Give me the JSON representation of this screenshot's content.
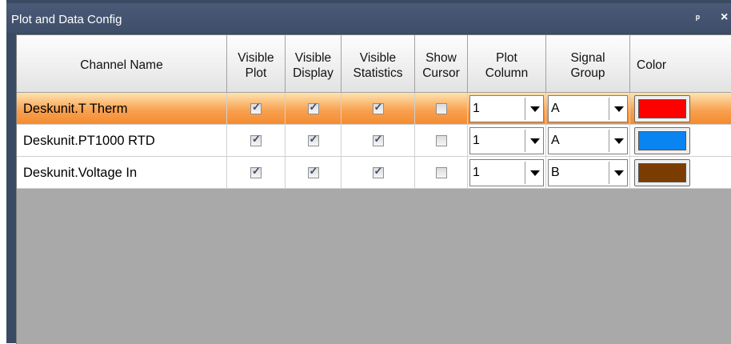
{
  "panel": {
    "title": "Plot and Data Config",
    "pin_glyph": "ᵖ",
    "close_glyph": "×"
  },
  "columns": {
    "channel_name": "Channel Name",
    "visible_plot": [
      "Visible",
      "Plot"
    ],
    "visible_display": [
      "Visible",
      "Display"
    ],
    "visible_statistics": [
      "Visible",
      "Statistics"
    ],
    "show_cursor": [
      "Show",
      "Cursor"
    ],
    "plot_column": [
      "Plot",
      "Column"
    ],
    "signal_group": [
      "Signal",
      "Group"
    ],
    "color": "Color"
  },
  "rows": [
    {
      "name": "Deskunit.T Therm",
      "visible_plot": true,
      "visible_display": true,
      "visible_statistics": true,
      "show_cursor": false,
      "plot_column": "1",
      "signal_group": "A",
      "color": "#ff0000",
      "selected": true
    },
    {
      "name": "Deskunit.PT1000 RTD",
      "visible_plot": true,
      "visible_display": true,
      "visible_statistics": true,
      "show_cursor": false,
      "plot_column": "1",
      "signal_group": "A",
      "color": "#0a84f0",
      "selected": false
    },
    {
      "name": "Deskunit.Voltage In",
      "visible_plot": true,
      "visible_display": true,
      "visible_statistics": true,
      "show_cursor": false,
      "plot_column": "1",
      "signal_group": "B",
      "color": "#7a3c00",
      "selected": false
    }
  ],
  "check_glyph": "✓"
}
